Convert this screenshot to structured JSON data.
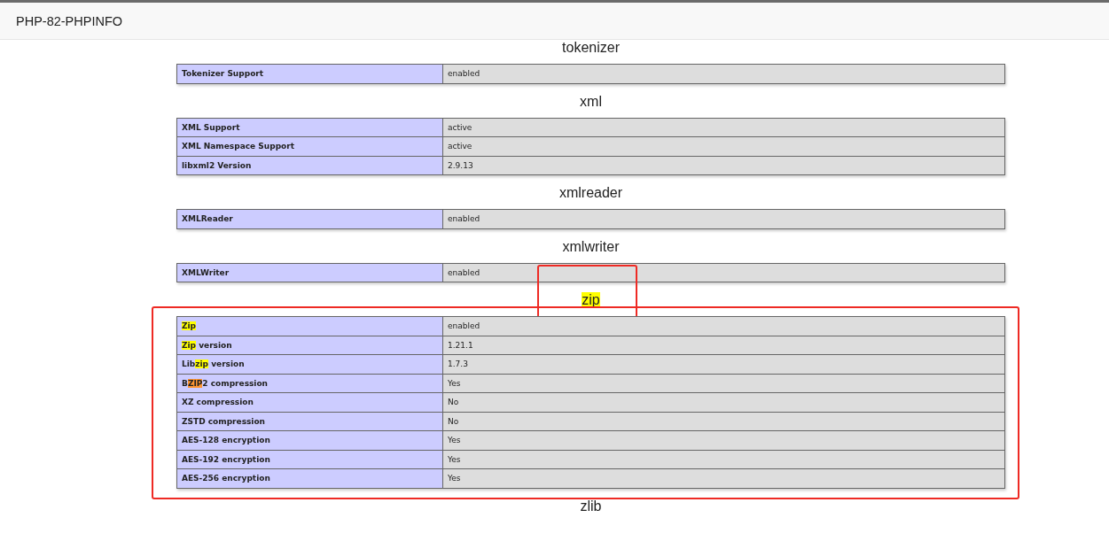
{
  "window": {
    "title": "PHP-82-PHPINFO"
  },
  "sections": [
    {
      "title": [
        {
          "text": "tokenizer"
        }
      ],
      "rows": [
        {
          "key": [
            {
              "text": "Tokenizer Support"
            }
          ],
          "value": "enabled"
        }
      ]
    },
    {
      "title": [
        {
          "text": "xml"
        }
      ],
      "rows": [
        {
          "key": [
            {
              "text": "XML Support"
            }
          ],
          "value": "active"
        },
        {
          "key": [
            {
              "text": "XML Namespace Support"
            }
          ],
          "value": "active"
        },
        {
          "key": [
            {
              "text": "libxml2 Version"
            }
          ],
          "value": "2.9.13"
        }
      ]
    },
    {
      "title": [
        {
          "text": "xmlreader"
        }
      ],
      "rows": [
        {
          "key": [
            {
              "text": "XMLReader"
            }
          ],
          "value": "enabled"
        }
      ]
    },
    {
      "title": [
        {
          "text": "xmlwriter"
        }
      ],
      "rows": [
        {
          "key": [
            {
              "text": "XMLWriter"
            }
          ],
          "value": "enabled"
        }
      ]
    },
    {
      "title": [
        {
          "text": "zip",
          "match": true
        }
      ],
      "boxed": true,
      "rows": [
        {
          "key": [
            {
              "text": "Zip",
              "match": true
            }
          ],
          "value": "enabled"
        },
        {
          "key": [
            {
              "text": "Zip",
              "match": true
            },
            {
              "text": " version"
            }
          ],
          "value": "1.21.1"
        },
        {
          "key": [
            {
              "text": "Lib"
            },
            {
              "text": "zip",
              "match": true
            },
            {
              "text": " version"
            }
          ],
          "value": "1.7.3"
        },
        {
          "key": [
            {
              "text": "B"
            },
            {
              "text": "ZIP",
              "match": true,
              "current": true
            },
            {
              "text": "2 compression"
            }
          ],
          "value": "Yes"
        },
        {
          "key": [
            {
              "text": "XZ compression"
            }
          ],
          "value": "No"
        },
        {
          "key": [
            {
              "text": "ZSTD compression"
            }
          ],
          "value": "No"
        },
        {
          "key": [
            {
              "text": "AES-128 encryption"
            }
          ],
          "value": "Yes"
        },
        {
          "key": [
            {
              "text": "AES-192 encryption"
            }
          ],
          "value": "Yes"
        },
        {
          "key": [
            {
              "text": "AES-256 encryption"
            }
          ],
          "value": "Yes"
        }
      ]
    },
    {
      "title": [
        {
          "text": "zlib"
        }
      ]
    }
  ]
}
